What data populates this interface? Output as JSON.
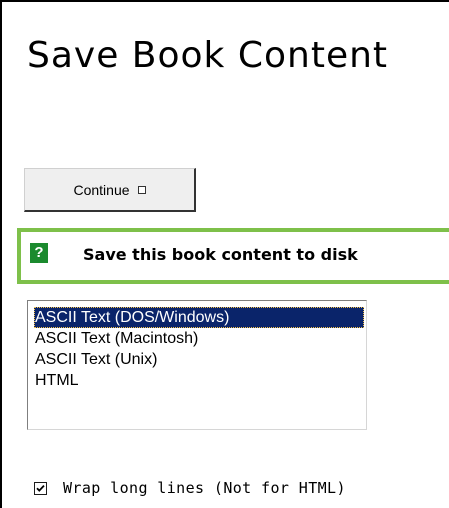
{
  "page": {
    "title": "Save Book Content"
  },
  "actions": {
    "continue_label": "Continue",
    "continue_icon": "square-bullet-icon"
  },
  "save_panel": {
    "help_icon": "help-question-icon",
    "help_glyph": "?",
    "heading": "Save this book content to disk",
    "accent_color": "#7ec04a",
    "help_icon_color": "#1b8a2e"
  },
  "format_list": {
    "options": [
      "ASCII Text (DOS/Windows)",
      "ASCII Text (Macintosh)",
      "ASCII Text (Unix)",
      "HTML"
    ],
    "selected": "ASCII Text (DOS/Windows)",
    "selection_color": "#0a246a"
  },
  "wrap_option": {
    "label": "Wrap long lines (Not for HTML)",
    "checked": true
  }
}
